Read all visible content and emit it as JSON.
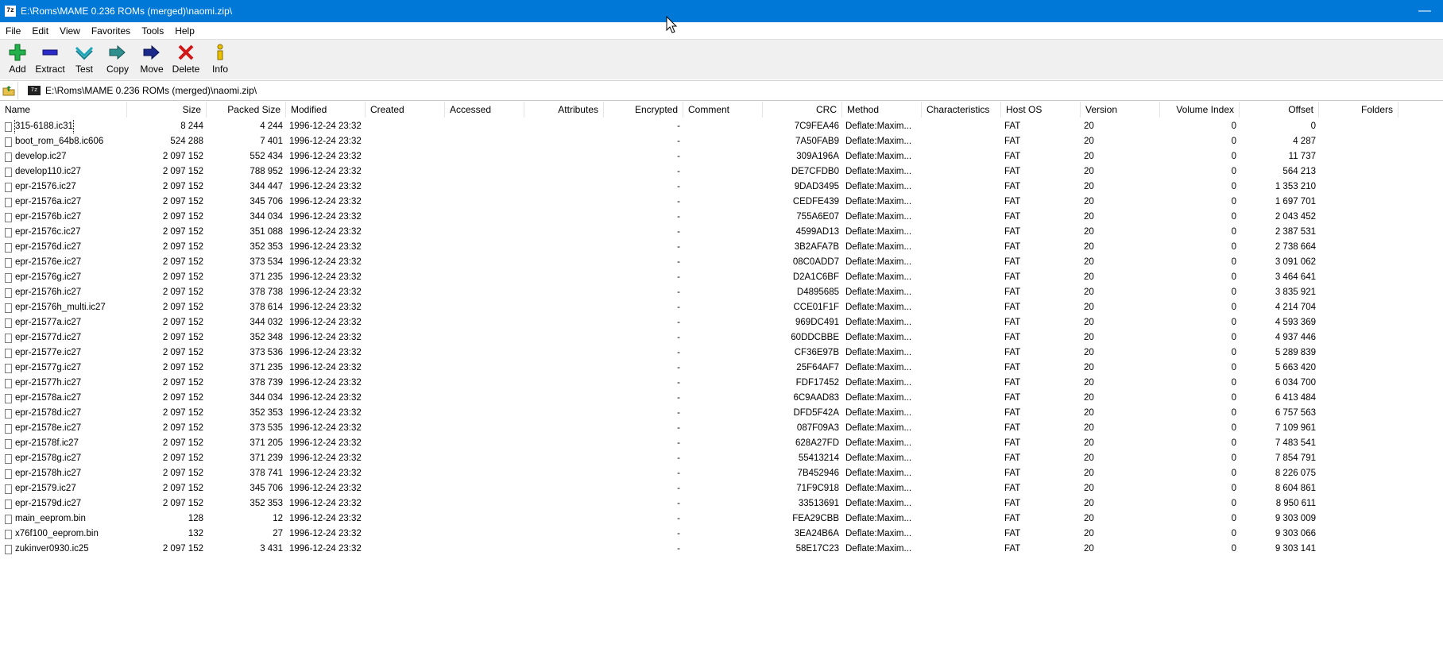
{
  "window": {
    "app_icon": "7z",
    "title": "E:\\Roms\\MAME 0.236 ROMs (merged)\\naomi.zip\\",
    "close_glyph": "—"
  },
  "menu": [
    "File",
    "Edit",
    "View",
    "Favorites",
    "Tools",
    "Help"
  ],
  "toolbar": {
    "add": "Add",
    "extract": "Extract",
    "test": "Test",
    "copy": "Copy",
    "move": "Move",
    "delete": "Delete",
    "info": "Info"
  },
  "address": {
    "path": "E:\\Roms\\MAME 0.236 ROMs (merged)\\naomi.zip\\"
  },
  "columns": {
    "name": "Name",
    "size": "Size",
    "packed": "Packed Size",
    "modified": "Modified",
    "created": "Created",
    "accessed": "Accessed",
    "attributes": "Attributes",
    "encrypted": "Encrypted",
    "comment": "Comment",
    "crc": "CRC",
    "method": "Method",
    "characteristics": "Characteristics",
    "hostos": "Host OS",
    "version": "Version",
    "volume": "Volume Index",
    "offset": "Offset",
    "folders": "Folders"
  },
  "files": [
    {
      "name": "315-6188.ic31",
      "size": "8 244",
      "packed": "4 244",
      "modified": "1996-12-24 23:32",
      "encrypted": "-",
      "crc": "7C9FEA46",
      "method": "Deflate:Maxim...",
      "hostos": "FAT",
      "version": "20",
      "volume": "0",
      "offset": "0"
    },
    {
      "name": "boot_rom_64b8.ic606",
      "size": "524 288",
      "packed": "7 401",
      "modified": "1996-12-24 23:32",
      "encrypted": "-",
      "crc": "7A50FAB9",
      "method": "Deflate:Maxim...",
      "hostos": "FAT",
      "version": "20",
      "volume": "0",
      "offset": "4 287"
    },
    {
      "name": "develop.ic27",
      "size": "2 097 152",
      "packed": "552 434",
      "modified": "1996-12-24 23:32",
      "encrypted": "-",
      "crc": "309A196A",
      "method": "Deflate:Maxim...",
      "hostos": "FAT",
      "version": "20",
      "volume": "0",
      "offset": "11 737"
    },
    {
      "name": "develop110.ic27",
      "size": "2 097 152",
      "packed": "788 952",
      "modified": "1996-12-24 23:32",
      "encrypted": "-",
      "crc": "DE7CFDB0",
      "method": "Deflate:Maxim...",
      "hostos": "FAT",
      "version": "20",
      "volume": "0",
      "offset": "564 213"
    },
    {
      "name": "epr-21576.ic27",
      "size": "2 097 152",
      "packed": "344 447",
      "modified": "1996-12-24 23:32",
      "encrypted": "-",
      "crc": "9DAD3495",
      "method": "Deflate:Maxim...",
      "hostos": "FAT",
      "version": "20",
      "volume": "0",
      "offset": "1 353 210"
    },
    {
      "name": "epr-21576a.ic27",
      "size": "2 097 152",
      "packed": "345 706",
      "modified": "1996-12-24 23:32",
      "encrypted": "-",
      "crc": "CEDFE439",
      "method": "Deflate:Maxim...",
      "hostos": "FAT",
      "version": "20",
      "volume": "0",
      "offset": "1 697 701"
    },
    {
      "name": "epr-21576b.ic27",
      "size": "2 097 152",
      "packed": "344 034",
      "modified": "1996-12-24 23:32",
      "encrypted": "-",
      "crc": "755A6E07",
      "method": "Deflate:Maxim...",
      "hostos": "FAT",
      "version": "20",
      "volume": "0",
      "offset": "2 043 452"
    },
    {
      "name": "epr-21576c.ic27",
      "size": "2 097 152",
      "packed": "351 088",
      "modified": "1996-12-24 23:32",
      "encrypted": "-",
      "crc": "4599AD13",
      "method": "Deflate:Maxim...",
      "hostos": "FAT",
      "version": "20",
      "volume": "0",
      "offset": "2 387 531"
    },
    {
      "name": "epr-21576d.ic27",
      "size": "2 097 152",
      "packed": "352 353",
      "modified": "1996-12-24 23:32",
      "encrypted": "-",
      "crc": "3B2AFA7B",
      "method": "Deflate:Maxim...",
      "hostos": "FAT",
      "version": "20",
      "volume": "0",
      "offset": "2 738 664"
    },
    {
      "name": "epr-21576e.ic27",
      "size": "2 097 152",
      "packed": "373 534",
      "modified": "1996-12-24 23:32",
      "encrypted": "-",
      "crc": "08C0ADD7",
      "method": "Deflate:Maxim...",
      "hostos": "FAT",
      "version": "20",
      "volume": "0",
      "offset": "3 091 062"
    },
    {
      "name": "epr-21576g.ic27",
      "size": "2 097 152",
      "packed": "371 235",
      "modified": "1996-12-24 23:32",
      "encrypted": "-",
      "crc": "D2A1C6BF",
      "method": "Deflate:Maxim...",
      "hostos": "FAT",
      "version": "20",
      "volume": "0",
      "offset": "3 464 641"
    },
    {
      "name": "epr-21576h.ic27",
      "size": "2 097 152",
      "packed": "378 738",
      "modified": "1996-12-24 23:32",
      "encrypted": "-",
      "crc": "D4895685",
      "method": "Deflate:Maxim...",
      "hostos": "FAT",
      "version": "20",
      "volume": "0",
      "offset": "3 835 921"
    },
    {
      "name": "epr-21576h_multi.ic27",
      "size": "2 097 152",
      "packed": "378 614",
      "modified": "1996-12-24 23:32",
      "encrypted": "-",
      "crc": "CCE01F1F",
      "method": "Deflate:Maxim...",
      "hostos": "FAT",
      "version": "20",
      "volume": "0",
      "offset": "4 214 704"
    },
    {
      "name": "epr-21577a.ic27",
      "size": "2 097 152",
      "packed": "344 032",
      "modified": "1996-12-24 23:32",
      "encrypted": "-",
      "crc": "969DC491",
      "method": "Deflate:Maxim...",
      "hostos": "FAT",
      "version": "20",
      "volume": "0",
      "offset": "4 593 369"
    },
    {
      "name": "epr-21577d.ic27",
      "size": "2 097 152",
      "packed": "352 348",
      "modified": "1996-12-24 23:32",
      "encrypted": "-",
      "crc": "60DDCBBE",
      "method": "Deflate:Maxim...",
      "hostos": "FAT",
      "version": "20",
      "volume": "0",
      "offset": "4 937 446"
    },
    {
      "name": "epr-21577e.ic27",
      "size": "2 097 152",
      "packed": "373 536",
      "modified": "1996-12-24 23:32",
      "encrypted": "-",
      "crc": "CF36E97B",
      "method": "Deflate:Maxim...",
      "hostos": "FAT",
      "version": "20",
      "volume": "0",
      "offset": "5 289 839"
    },
    {
      "name": "epr-21577g.ic27",
      "size": "2 097 152",
      "packed": "371 235",
      "modified": "1996-12-24 23:32",
      "encrypted": "-",
      "crc": "25F64AF7",
      "method": "Deflate:Maxim...",
      "hostos": "FAT",
      "version": "20",
      "volume": "0",
      "offset": "5 663 420"
    },
    {
      "name": "epr-21577h.ic27",
      "size": "2 097 152",
      "packed": "378 739",
      "modified": "1996-12-24 23:32",
      "encrypted": "-",
      "crc": "FDF17452",
      "method": "Deflate:Maxim...",
      "hostos": "FAT",
      "version": "20",
      "volume": "0",
      "offset": "6 034 700"
    },
    {
      "name": "epr-21578a.ic27",
      "size": "2 097 152",
      "packed": "344 034",
      "modified": "1996-12-24 23:32",
      "encrypted": "-",
      "crc": "6C9AAD83",
      "method": "Deflate:Maxim...",
      "hostos": "FAT",
      "version": "20",
      "volume": "0",
      "offset": "6 413 484"
    },
    {
      "name": "epr-21578d.ic27",
      "size": "2 097 152",
      "packed": "352 353",
      "modified": "1996-12-24 23:32",
      "encrypted": "-",
      "crc": "DFD5F42A",
      "method": "Deflate:Maxim...",
      "hostos": "FAT",
      "version": "20",
      "volume": "0",
      "offset": "6 757 563"
    },
    {
      "name": "epr-21578e.ic27",
      "size": "2 097 152",
      "packed": "373 535",
      "modified": "1996-12-24 23:32",
      "encrypted": "-",
      "crc": "087F09A3",
      "method": "Deflate:Maxim...",
      "hostos": "FAT",
      "version": "20",
      "volume": "0",
      "offset": "7 109 961"
    },
    {
      "name": "epr-21578f.ic27",
      "size": "2 097 152",
      "packed": "371 205",
      "modified": "1996-12-24 23:32",
      "encrypted": "-",
      "crc": "628A27FD",
      "method": "Deflate:Maxim...",
      "hostos": "FAT",
      "version": "20",
      "volume": "0",
      "offset": "7 483 541"
    },
    {
      "name": "epr-21578g.ic27",
      "size": "2 097 152",
      "packed": "371 239",
      "modified": "1996-12-24 23:32",
      "encrypted": "-",
      "crc": "55413214",
      "method": "Deflate:Maxim...",
      "hostos": "FAT",
      "version": "20",
      "volume": "0",
      "offset": "7 854 791"
    },
    {
      "name": "epr-21578h.ic27",
      "size": "2 097 152",
      "packed": "378 741",
      "modified": "1996-12-24 23:32",
      "encrypted": "-",
      "crc": "7B452946",
      "method": "Deflate:Maxim...",
      "hostos": "FAT",
      "version": "20",
      "volume": "0",
      "offset": "8 226 075"
    },
    {
      "name": "epr-21579.ic27",
      "size": "2 097 152",
      "packed": "345 706",
      "modified": "1996-12-24 23:32",
      "encrypted": "-",
      "crc": "71F9C918",
      "method": "Deflate:Maxim...",
      "hostos": "FAT",
      "version": "20",
      "volume": "0",
      "offset": "8 604 861"
    },
    {
      "name": "epr-21579d.ic27",
      "size": "2 097 152",
      "packed": "352 353",
      "modified": "1996-12-24 23:32",
      "encrypted": "-",
      "crc": "33513691",
      "method": "Deflate:Maxim...",
      "hostos": "FAT",
      "version": "20",
      "volume": "0",
      "offset": "8 950 611"
    },
    {
      "name": "main_eeprom.bin",
      "size": "128",
      "packed": "12",
      "modified": "1996-12-24 23:32",
      "encrypted": "-",
      "crc": "FEA29CBB",
      "method": "Deflate:Maxim...",
      "hostos": "FAT",
      "version": "20",
      "volume": "0",
      "offset": "9 303 009"
    },
    {
      "name": "x76f100_eeprom.bin",
      "size": "132",
      "packed": "27",
      "modified": "1996-12-24 23:32",
      "encrypted": "-",
      "crc": "3EA24B6A",
      "method": "Deflate:Maxim...",
      "hostos": "FAT",
      "version": "20",
      "volume": "0",
      "offset": "9 303 066"
    },
    {
      "name": "zukinver0930.ic25",
      "size": "2 097 152",
      "packed": "3 431",
      "modified": "1996-12-24 23:32",
      "encrypted": "-",
      "crc": "58E17C23",
      "method": "Deflate:Maxim...",
      "hostos": "FAT",
      "version": "20",
      "volume": "0",
      "offset": "9 303 141"
    }
  ]
}
